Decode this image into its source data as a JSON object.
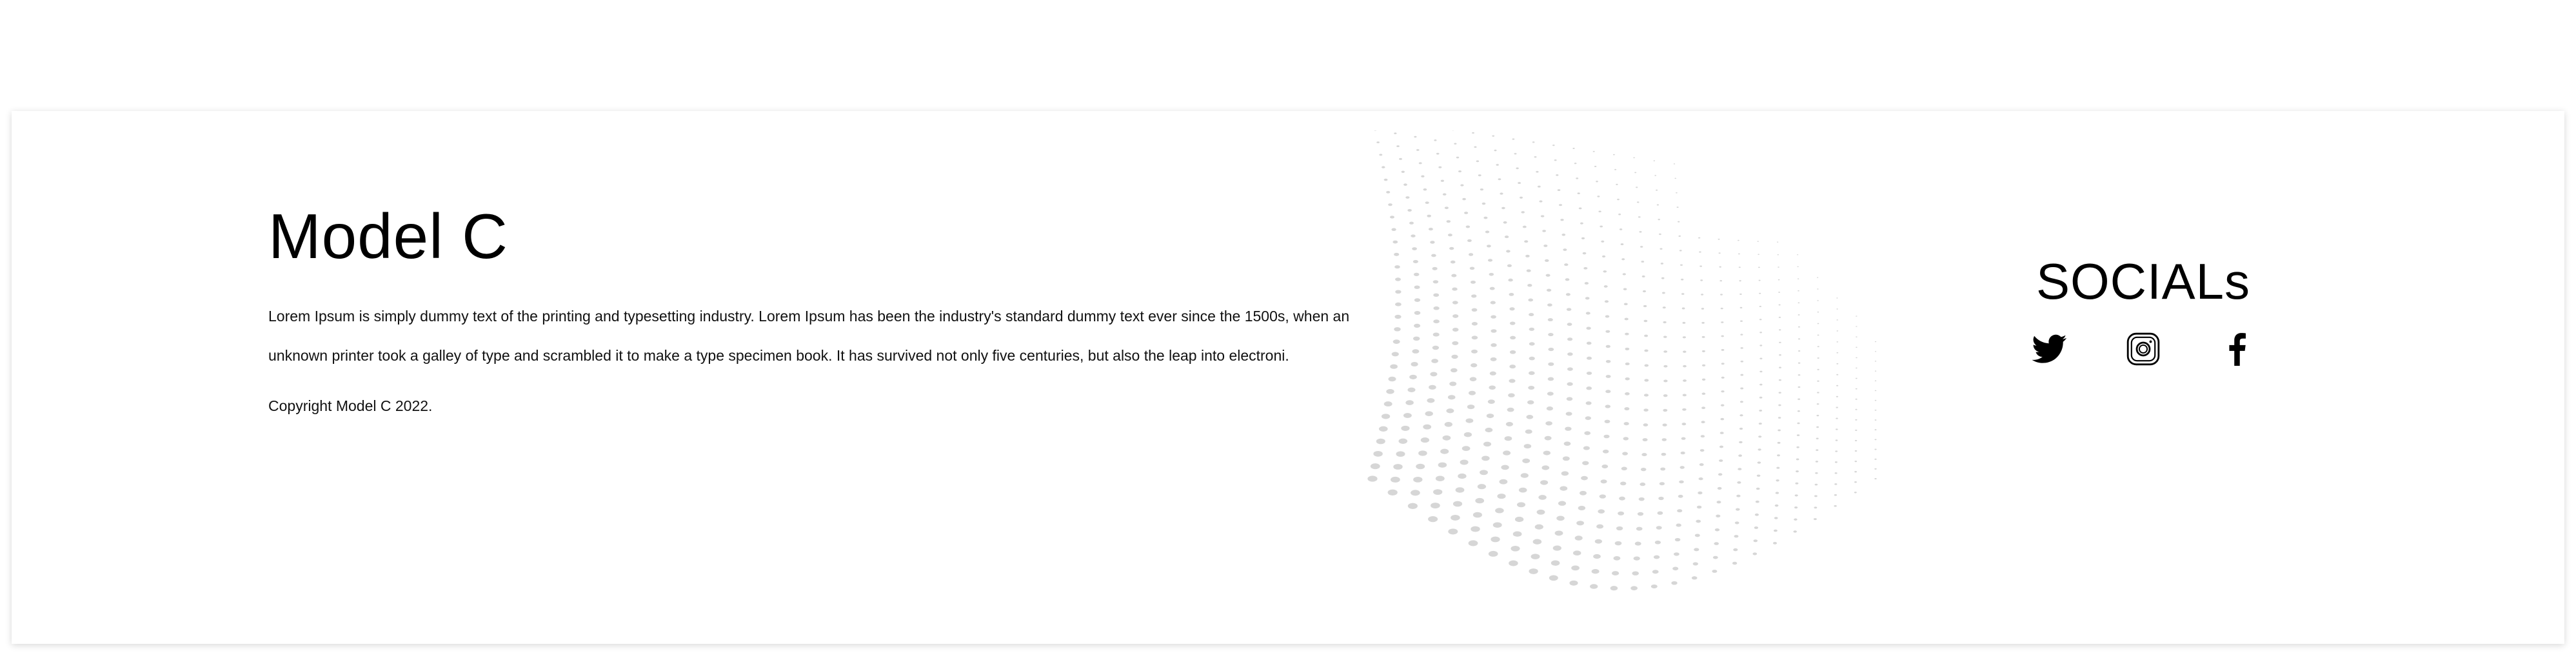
{
  "footer": {
    "brand": {
      "title": "Model C",
      "description": "Lorem Ipsum is simply dummy text of the printing and typesetting industry. Lorem Ipsum has been the industry's standard dummy text ever since the 1500s, when an unknown printer took a galley of type and scrambled it to make a type specimen book. It has survived not only five centuries, but also the leap into electroni.",
      "copyright": "Copyright Model C  2022."
    },
    "socials": {
      "title": "SOCIALs",
      "links": [
        {
          "name": "twitter",
          "icon": "twitter-icon"
        },
        {
          "name": "instagram",
          "icon": "instagram-icon"
        },
        {
          "name": "facebook",
          "icon": "facebook-icon"
        }
      ]
    },
    "decoration": {
      "dot_color": "#d6d6d6"
    }
  }
}
